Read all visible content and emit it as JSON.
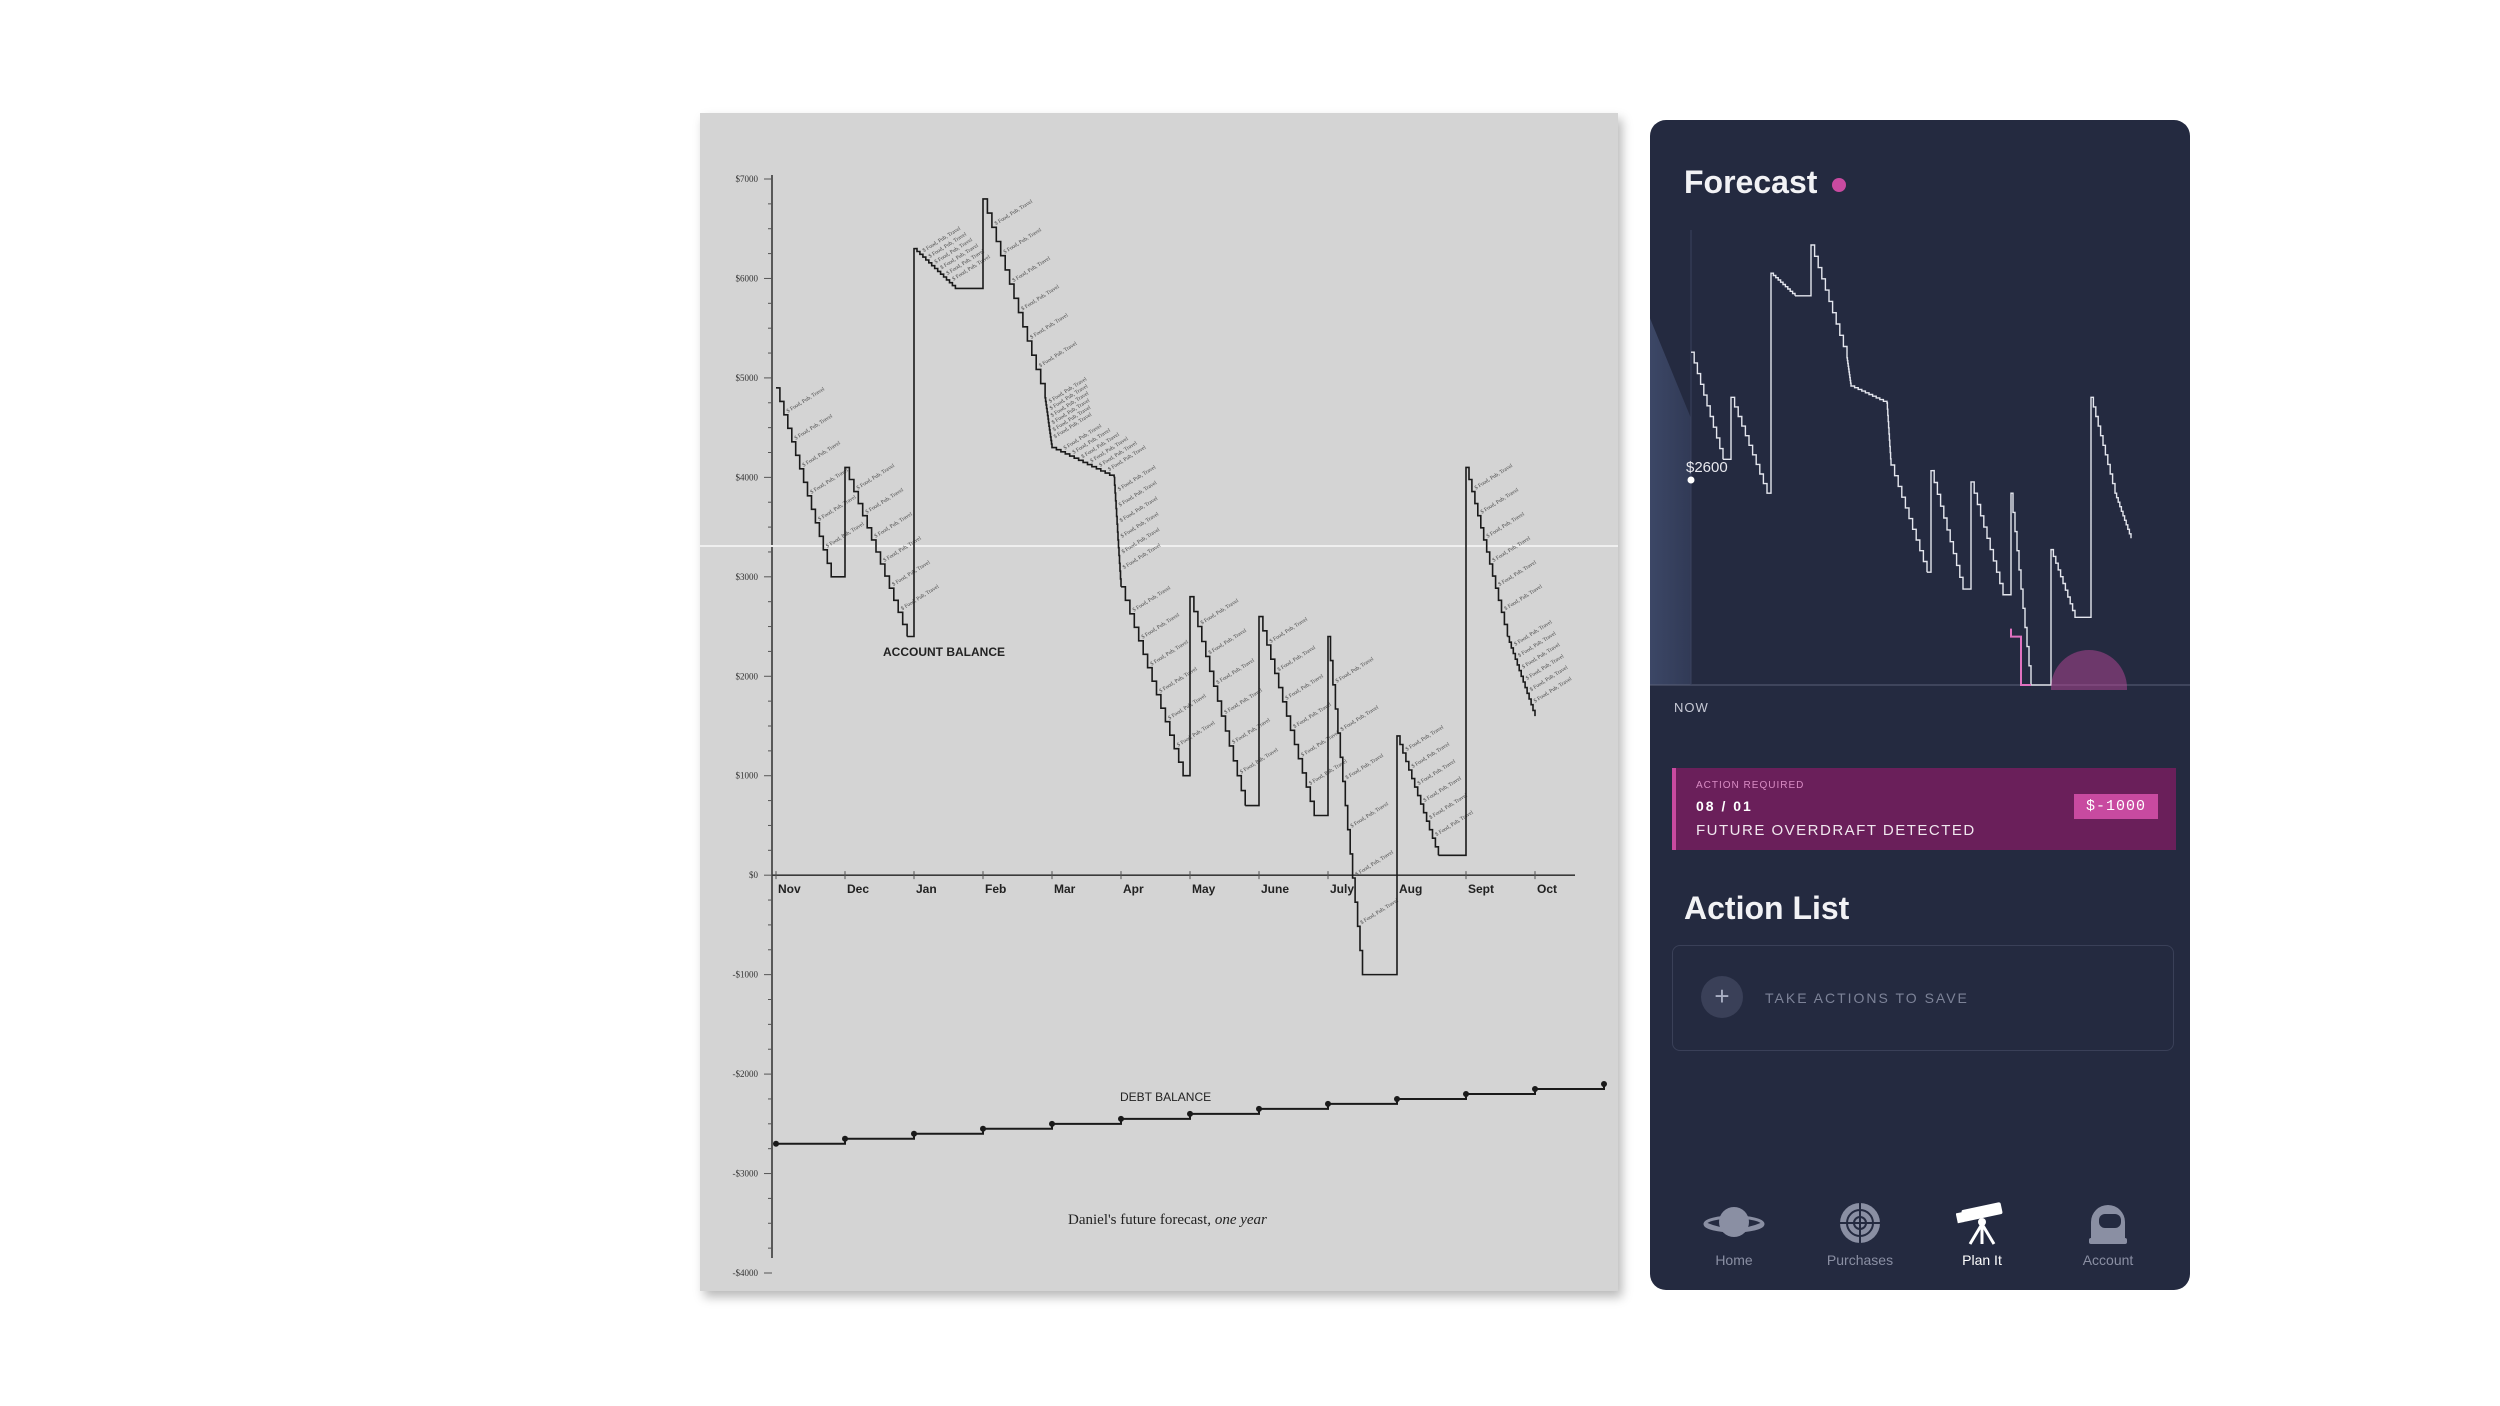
{
  "poster": {
    "y_labels": [
      "$7000",
      "$6000",
      "$5000",
      "$4000",
      "$3000",
      "$2000",
      "$1000",
      "$0",
      "-$1000",
      "-$2000",
      "-$3000",
      "-$4000"
    ],
    "months": [
      "Nov",
      "Dec",
      "Jan",
      "Feb",
      "Mar",
      "Apr",
      "May",
      "June",
      "July",
      "Aug",
      "Sept",
      "Oct"
    ],
    "account_label": "ACCOUNT BALANCE",
    "debt_label": "DEBT BALANCE",
    "caption_main": "Daniel's future forecast, ",
    "caption_em": "one year",
    "annotation_sample": "$ Food, Pub, Travel"
  },
  "chart_data": [
    {
      "type": "line",
      "series": [
        {
          "name": "ACCOUNT BALANCE",
          "x": [
            0,
            0.8,
            1,
            1.9,
            2,
            2.6,
            3,
            3.9,
            4,
            4.9,
            5,
            5.9,
            6,
            6.8,
            7,
            7.8,
            8,
            8.5,
            9,
            9.6,
            10,
            10.6,
            11
          ],
          "values": [
            4900,
            3000,
            4100,
            2400,
            6300,
            5900,
            6800,
            4800,
            4300,
            4000,
            2900,
            1000,
            2800,
            700,
            2600,
            600,
            2400,
            -1000,
            1400,
            200,
            4100,
            2400,
            1600
          ]
        },
        {
          "name": "DEBT BALANCE",
          "x": [
            0,
            1,
            2,
            3,
            4,
            5,
            6,
            7,
            8,
            9,
            10,
            11,
            12
          ],
          "values": [
            -2700,
            -2650,
            -2600,
            -2550,
            -2500,
            -2450,
            -2400,
            -2350,
            -2300,
            -2250,
            -2200,
            -2150,
            -2100
          ]
        }
      ],
      "ylim": [
        -4000,
        7000
      ]
    }
  ],
  "app": {
    "forecast_title": "Forecast",
    "current_value_label": "$2600",
    "now_label": "NOW",
    "alert": {
      "kicker": "ACTION REQUIRED",
      "date": "08 / 01",
      "message": "FUTURE OVERDRAFT DETECTED",
      "amount": "$-1000"
    },
    "action_list_title": "Action List",
    "action_placeholder": "TAKE ACTIONS TO SAVE",
    "add_symbol": "+",
    "tabs": [
      {
        "label": "Home",
        "icon": "planet-icon"
      },
      {
        "label": "Purchases",
        "icon": "target-icon"
      },
      {
        "label": "Plan It",
        "icon": "telescope-icon"
      },
      {
        "label": "Account",
        "icon": "astronaut-helmet-icon"
      }
    ],
    "active_tab": "Plan It",
    "colors": {
      "accent": "#c84aa0",
      "background": "#242a40",
      "alert_bg": "#6a1f5a"
    }
  }
}
